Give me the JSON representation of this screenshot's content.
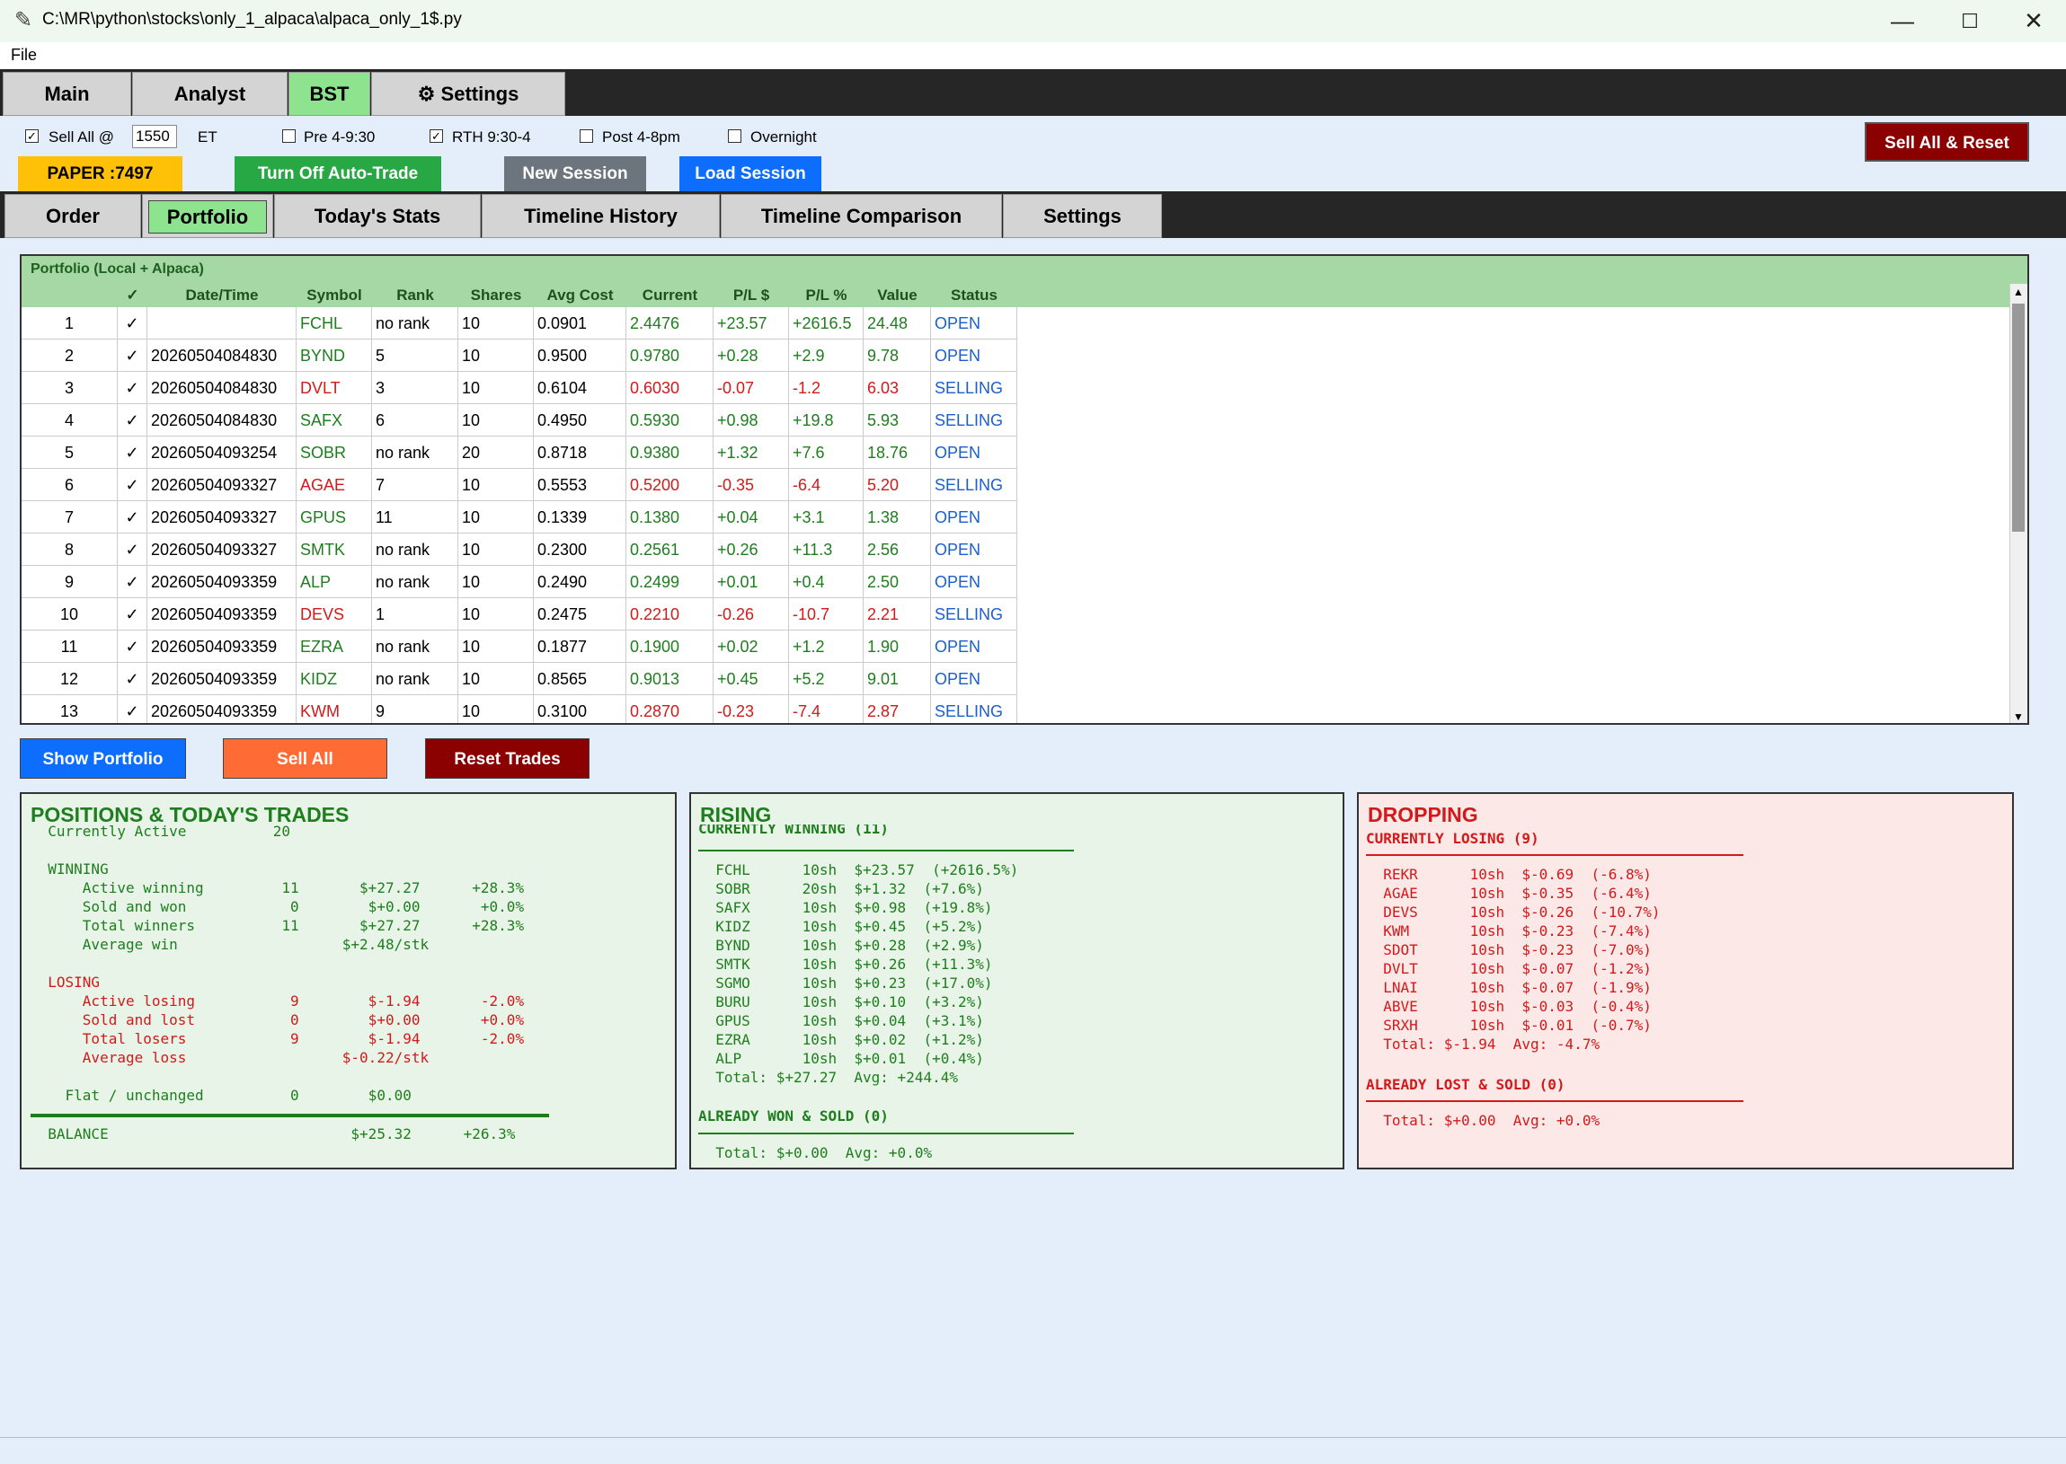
{
  "window": {
    "title": "C:\\MR\\python\\stocks\\only_1_alpaca\\alpaca_only_1$.py",
    "minimize": "—",
    "maximize": "☐",
    "close": "✕"
  },
  "menu": {
    "file": "File"
  },
  "main_tabs": [
    {
      "label": "Main"
    },
    {
      "label": "Analyst"
    },
    {
      "label": "BST"
    },
    {
      "label": "Settings",
      "icon": "gear-icon"
    }
  ],
  "controls": {
    "sell_all_label": "Sell All @",
    "sell_all_checked": true,
    "sell_all_time": "1550",
    "et_label": "ET",
    "pre_label": "Pre 4-9:30",
    "pre_checked": false,
    "rth_label": "RTH 9:30-4",
    "rth_checked": true,
    "post_label": "Post 4-8pm",
    "post_checked": false,
    "overnight_label": "Overnight",
    "overnight_checked": false,
    "sell_all_reset": "Sell All & Reset",
    "paper": "PAPER :7497",
    "auto_trade": "Turn Off Auto-Trade",
    "new_session": "New Session",
    "load_session": "Load Session"
  },
  "sub_tabs": [
    {
      "label": "Order"
    },
    {
      "label": "Portfolio"
    },
    {
      "label": "Today's Stats"
    },
    {
      "label": "Timeline History"
    },
    {
      "label": "Timeline Comparison"
    },
    {
      "label": "Settings"
    }
  ],
  "portfolio": {
    "title": "Portfolio (Local + Alpaca)",
    "headers": [
      "",
      "✓",
      "Date/Time",
      "Symbol",
      "Rank",
      "Shares",
      "Avg Cost",
      "Current",
      "P/L $",
      "P/L %",
      "Value",
      "Status"
    ],
    "rows": [
      {
        "idx": "1",
        "check": "✓",
        "dt": "",
        "sym": "FCHL",
        "rank": "no rank",
        "shares": "10",
        "avg": "0.0901",
        "cur": "2.4476",
        "pl": "+23.57",
        "plp": "+2616.5",
        "val": "24.48",
        "status": "OPEN",
        "color": "green"
      },
      {
        "idx": "2",
        "check": "✓",
        "dt": "20260504084830",
        "sym": "BYND",
        "rank": "5",
        "shares": "10",
        "avg": "0.9500",
        "cur": "0.9780",
        "pl": "+0.28",
        "plp": "+2.9",
        "val": "9.78",
        "status": "OPEN",
        "color": "green"
      },
      {
        "idx": "3",
        "check": "✓",
        "dt": "20260504084830",
        "sym": "DVLT",
        "rank": "3",
        "shares": "10",
        "avg": "0.6104",
        "cur": "0.6030",
        "pl": "-0.07",
        "plp": "-1.2",
        "val": "6.03",
        "status": "SELLING",
        "color": "red"
      },
      {
        "idx": "4",
        "check": "✓",
        "dt": "20260504084830",
        "sym": "SAFX",
        "rank": "6",
        "shares": "10",
        "avg": "0.4950",
        "cur": "0.5930",
        "pl": "+0.98",
        "plp": "+19.8",
        "val": "5.93",
        "status": "SELLING",
        "color": "green"
      },
      {
        "idx": "5",
        "check": "✓",
        "dt": "20260504093254",
        "sym": "SOBR",
        "rank": "no rank",
        "shares": "20",
        "avg": "0.8718",
        "cur": "0.9380",
        "pl": "+1.32",
        "plp": "+7.6",
        "val": "18.76",
        "status": "OPEN",
        "color": "green"
      },
      {
        "idx": "6",
        "check": "✓",
        "dt": "20260504093327",
        "sym": "AGAE",
        "rank": "7",
        "shares": "10",
        "avg": "0.5553",
        "cur": "0.5200",
        "pl": "-0.35",
        "plp": "-6.4",
        "val": "5.20",
        "status": "SELLING",
        "color": "red"
      },
      {
        "idx": "7",
        "check": "✓",
        "dt": "20260504093327",
        "sym": "GPUS",
        "rank": "11",
        "shares": "10",
        "avg": "0.1339",
        "cur": "0.1380",
        "pl": "+0.04",
        "plp": "+3.1",
        "val": "1.38",
        "status": "OPEN",
        "color": "green"
      },
      {
        "idx": "8",
        "check": "✓",
        "dt": "20260504093327",
        "sym": "SMTK",
        "rank": "no rank",
        "shares": "10",
        "avg": "0.2300",
        "cur": "0.2561",
        "pl": "+0.26",
        "plp": "+11.3",
        "val": "2.56",
        "status": "OPEN",
        "color": "green"
      },
      {
        "idx": "9",
        "check": "✓",
        "dt": "20260504093359",
        "sym": "ALP",
        "rank": "no rank",
        "shares": "10",
        "avg": "0.2490",
        "cur": "0.2499",
        "pl": "+0.01",
        "plp": "+0.4",
        "val": "2.50",
        "status": "OPEN",
        "color": "green"
      },
      {
        "idx": "10",
        "check": "✓",
        "dt": "20260504093359",
        "sym": "DEVS",
        "rank": "1",
        "shares": "10",
        "avg": "0.2475",
        "cur": "0.2210",
        "pl": "-0.26",
        "plp": "-10.7",
        "val": "2.21",
        "status": "SELLING",
        "color": "red"
      },
      {
        "idx": "11",
        "check": "✓",
        "dt": "20260504093359",
        "sym": "EZRA",
        "rank": "no rank",
        "shares": "10",
        "avg": "0.1877",
        "cur": "0.1900",
        "pl": "+0.02",
        "plp": "+1.2",
        "val": "1.90",
        "status": "OPEN",
        "color": "green"
      },
      {
        "idx": "12",
        "check": "✓",
        "dt": "20260504093359",
        "sym": "KIDZ",
        "rank": "no rank",
        "shares": "10",
        "avg": "0.8565",
        "cur": "0.9013",
        "pl": "+0.45",
        "plp": "+5.2",
        "val": "9.01",
        "status": "OPEN",
        "color": "green"
      },
      {
        "idx": "13",
        "check": "✓",
        "dt": "20260504093359",
        "sym": "KWM",
        "rank": "9",
        "shares": "10",
        "avg": "0.3100",
        "cur": "0.2870",
        "pl": "-0.23",
        "plp": "-7.4",
        "val": "2.87",
        "status": "SELLING",
        "color": "red"
      }
    ]
  },
  "actions": {
    "show_portfolio": "Show Portfolio",
    "sell_all": "Sell All",
    "reset_trades": "Reset Trades"
  },
  "positions": {
    "title": "POSITIONS & TODAY'S TRADES",
    "lines": [
      {
        "t": "  Currently Active          20",
        "c": "green"
      },
      {
        "t": "",
        "c": "green"
      },
      {
        "t": "  WINNING",
        "c": "green"
      },
      {
        "t": "      Active winning         11       $+27.27      +28.3%",
        "c": "green"
      },
      {
        "t": "      Sold and won            0        $+0.00       +0.0%",
        "c": "green"
      },
      {
        "t": "      Total winners          11       $+27.27      +28.3%",
        "c": "green"
      },
      {
        "t": "      Average win                   $+2.48/stk",
        "c": "green"
      },
      {
        "t": "",
        "c": "green"
      },
      {
        "t": "  LOSING",
        "c": "red"
      },
      {
        "t": "      Active losing           9        $-1.94       -2.0%",
        "c": "red"
      },
      {
        "t": "      Sold and lost           0        $+0.00       +0.0%",
        "c": "red"
      },
      {
        "t": "      Total losers            9        $-1.94       -2.0%",
        "c": "red"
      },
      {
        "t": "      Average loss                  $-0.22/stk",
        "c": "red"
      },
      {
        "t": "",
        "c": "green"
      },
      {
        "t": "    Flat / unchanged          0        $0.00",
        "c": "green"
      }
    ],
    "balance": "  BALANCE                            $+25.32      +26.3%"
  },
  "rising": {
    "title": "RISING",
    "header": "CURRENTLY WINNING (11)",
    "lines": [
      "  FCHL      10sh  $+23.57  (+2616.5%)",
      "  SOBR      20sh  $+1.32  (+7.6%)",
      "  SAFX      10sh  $+0.98  (+19.8%)",
      "  KIDZ      10sh  $+0.45  (+5.2%)",
      "  BYND      10sh  $+0.28  (+2.9%)",
      "  SMTK      10sh  $+0.26  (+11.3%)",
      "  SGMO      10sh  $+0.23  (+17.0%)",
      "  BURU      10sh  $+0.10  (+3.2%)",
      "  GPUS      10sh  $+0.04  (+3.1%)",
      "  EZRA      10sh  $+0.02  (+1.2%)",
      "  ALP       10sh  $+0.01  (+0.4%)",
      "  Total: $+27.27  Avg: +244.4%"
    ],
    "sold_header": "ALREADY WON & SOLD (0)",
    "sold_total": "  Total: $+0.00  Avg: +0.0%"
  },
  "dropping": {
    "title": "DROPPING",
    "header": "CURRENTLY LOSING (9)",
    "lines": [
      "  REKR      10sh  $-0.69  (-6.8%)",
      "  AGAE      10sh  $-0.35  (-6.4%)",
      "  DEVS      10sh  $-0.26  (-10.7%)",
      "  KWM       10sh  $-0.23  (-7.4%)",
      "  SDOT      10sh  $-0.23  (-7.0%)",
      "  DVLT      10sh  $-0.07  (-1.2%)",
      "  LNAI      10sh  $-0.07  (-1.9%)",
      "  ABVE      10sh  $-0.03  (-0.4%)",
      "  SRXH      10sh  $-0.01  (-0.7%)",
      "  Total: $-1.94  Avg: -4.7%"
    ],
    "sold_header": "ALREADY LOST & SOLD (0)",
    "sold_total": "  Total: $+0.00  Avg: +0.0%"
  },
  "colors": {
    "green": "#1e7e1e",
    "red": "#d11a1a",
    "blue": "#1a5fd1",
    "header_green": "#a6d8a6"
  }
}
